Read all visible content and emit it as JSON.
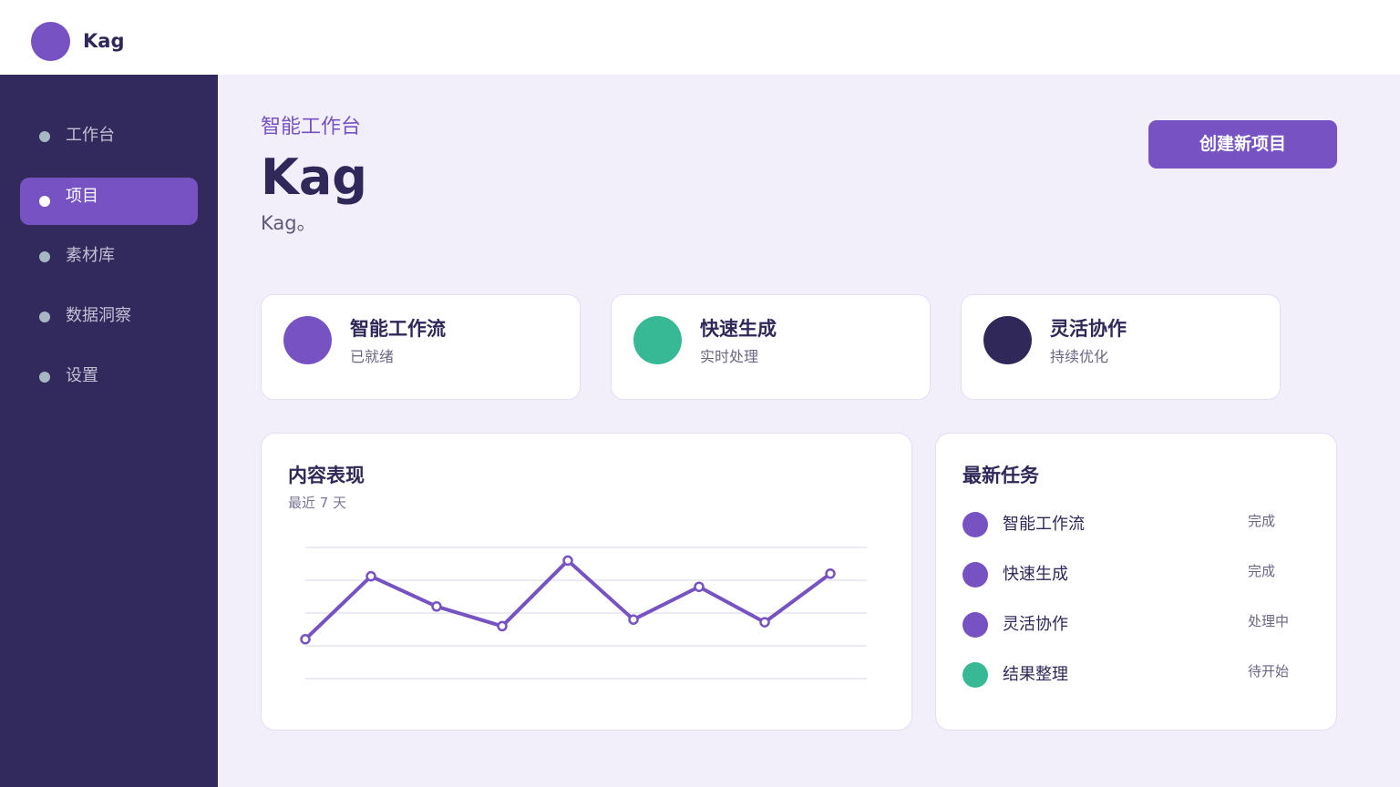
{
  "app": {
    "brand": "Kag"
  },
  "sidebar": {
    "items": [
      {
        "label": "工作台",
        "active": false
      },
      {
        "label": "项目",
        "active": true
      },
      {
        "label": "素材库",
        "active": false
      },
      {
        "label": "数据洞察",
        "active": false
      },
      {
        "label": "设置",
        "active": false
      }
    ]
  },
  "header": {
    "eyebrow": "智能工作台",
    "title": "Kag",
    "subtitle": "Kag。",
    "create_button": "创建新项目"
  },
  "stats": [
    {
      "title": "智能工作流",
      "subtitle": "已就绪",
      "color": "#7652c3"
    },
    {
      "title": "快速生成",
      "subtitle": "实时处理",
      "color": "#36b994"
    },
    {
      "title": "灵活协作",
      "subtitle": "持续优化",
      "color": "#2f2858"
    }
  ],
  "performance": {
    "title": "内容表现",
    "subtitle": "最近 7 天"
  },
  "chart_data": {
    "type": "line",
    "x": [
      1,
      2,
      3,
      4,
      5,
      6,
      7,
      8,
      9
    ],
    "series": [
      {
        "values": [
          30,
          78,
          55,
          40,
          90,
          45,
          70,
          43,
          80
        ]
      }
    ],
    "ylim": [
      0,
      100
    ],
    "grid": true,
    "line_color": "#7652c3"
  },
  "tasks": {
    "title": "最新任务",
    "items": [
      {
        "name": "智能工作流",
        "status": "完成",
        "color": "#7652c3"
      },
      {
        "name": "快速生成",
        "status": "完成",
        "color": "#7652c3"
      },
      {
        "name": "灵活协作",
        "status": "处理中",
        "color": "#7652c3"
      },
      {
        "name": "结果整理",
        "status": "待开始",
        "color": "#36b994"
      }
    ]
  }
}
